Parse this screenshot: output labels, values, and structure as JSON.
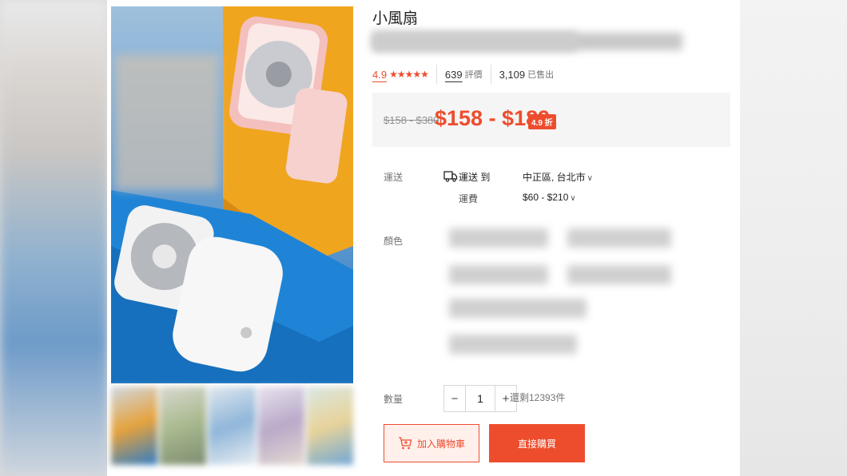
{
  "product": {
    "title": "小風扇",
    "rating": "4.9",
    "stars": "★★★★★",
    "reviews_count": "639",
    "reviews_label": "評價",
    "sold_count": "3,109",
    "sold_label": "已售出"
  },
  "price": {
    "original": "$158 - $380",
    "current": "$158 - $189",
    "discount": "4.9 折"
  },
  "shipping": {
    "label": "運送",
    "to_label": "運送 到",
    "location": "中正區, 台北市",
    "fee_label": "運費",
    "fee": "$60 - $210"
  },
  "variants": {
    "label": "顏色"
  },
  "quantity": {
    "label": "數量",
    "minus": "−",
    "value": "1",
    "plus": "+",
    "stock": "還剩12393件"
  },
  "actions": {
    "add_to_cart": "加入購物車",
    "buy_now": "直接購買"
  },
  "colors": {
    "accent": "#ee4d2d",
    "price_bg": "#f5f5f5"
  }
}
